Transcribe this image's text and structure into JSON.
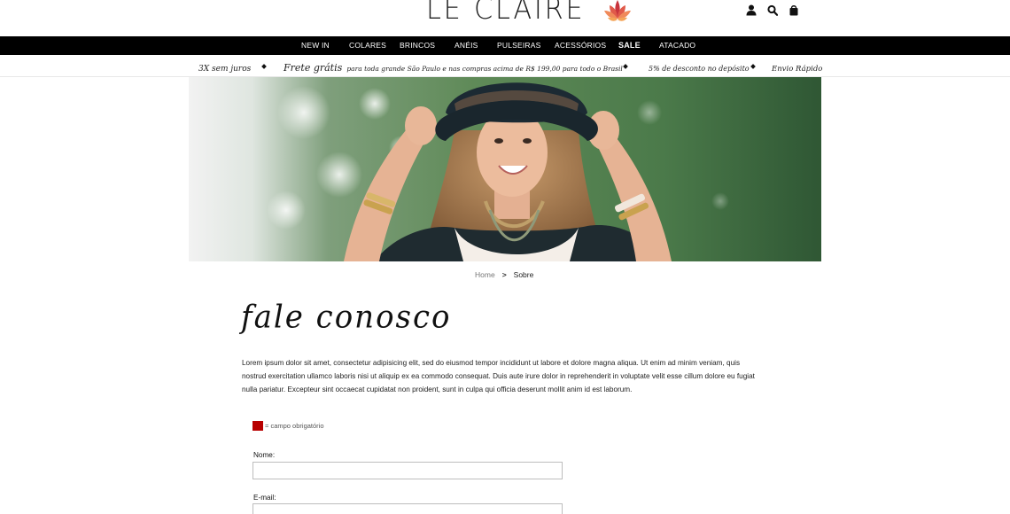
{
  "header": {
    "logo_text": "LE CLAIRE",
    "icons": [
      "user-icon",
      "search-icon",
      "shopping-bag-icon"
    ]
  },
  "nav": {
    "items": [
      {
        "label": "NEW IN",
        "bold": false
      },
      {
        "label": "COLARES",
        "bold": false
      },
      {
        "label": "BRINCOS",
        "bold": false
      },
      {
        "label": "ANÉIS",
        "bold": false
      },
      {
        "label": "PULSEIRAS",
        "bold": false
      },
      {
        "label": "ACESSÓRIOS",
        "bold": false
      },
      {
        "label": "SALE",
        "bold": true
      },
      {
        "label": "ATACADO",
        "bold": false
      }
    ]
  },
  "promo": {
    "installments": "3X sem juros",
    "shipping_big": "Frete grátis",
    "shipping_small": "para toda grande São Paulo e nas compras acima de R$ 199,00 para todo o Brasil",
    "deposit": "5% de desconto no depósito",
    "fast": "Envio Rápido"
  },
  "breadcrumb": {
    "home": "Home",
    "separator": ">",
    "current": "Sobre"
  },
  "page": {
    "title": "fale conosco",
    "intro": "Lorem ipsum dolor sit amet, consectetur adipisicing elit, sed do eiusmod tempor incididunt ut labore et dolore magna aliqua. Ut enim ad minim veniam, quis nostrud exercitation ullamco laboris nisi ut aliquip ex ea commodo consequat. Duis aute irure dolor in reprehenderit in voluptate velit esse cillum dolore eu fugiat nulla pariatur. Excepteur sint occaecat cupidatat non proident, sunt in culpa qui officia deserunt mollit anim id est laborum."
  },
  "form": {
    "required_note": "= campo obrigatório",
    "name_label": "Nome:",
    "name_value": "",
    "email_label": "E-mail:",
    "email_value": ""
  },
  "colors": {
    "navbar_bg": "#000000",
    "required_marker": "#b80000",
    "logo_flower": "#d8474b"
  }
}
